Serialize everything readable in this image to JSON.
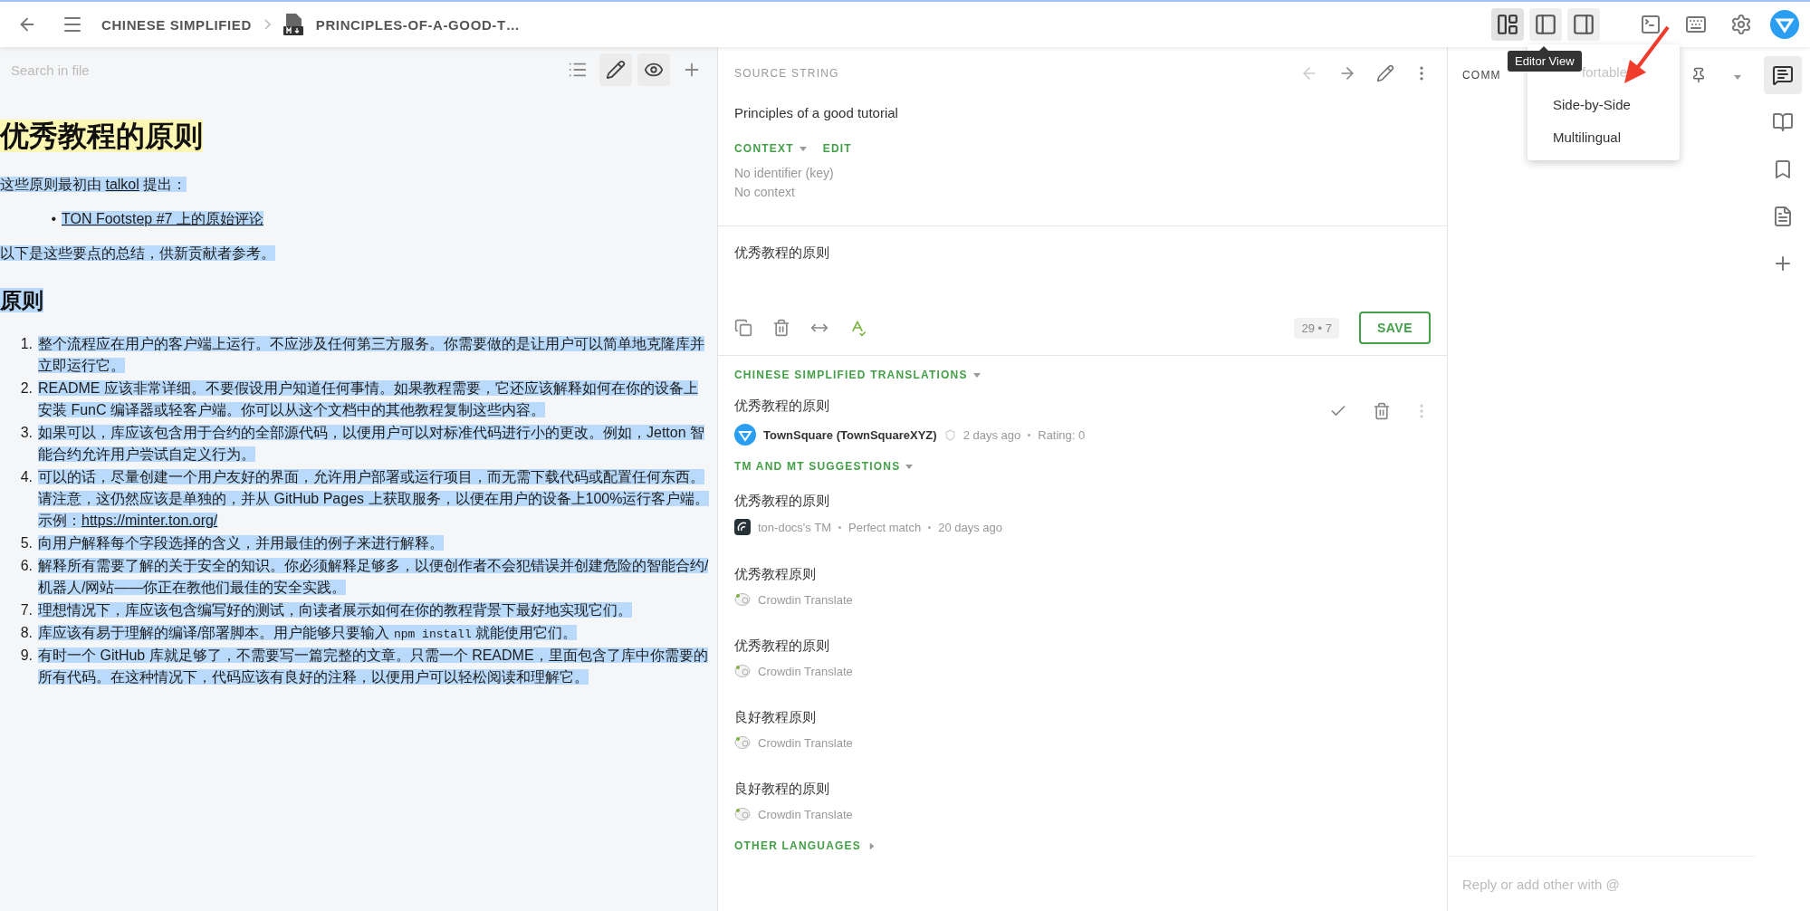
{
  "top_bar": {
    "breadcrumb": [
      {
        "label": "CHINESE SIMPLIFIED"
      },
      {
        "label": "PRINCIPLES-OF-A-GOOD-T…"
      }
    ],
    "layout_buttons": [
      {
        "kind": "editor",
        "selected": true
      },
      {
        "kind": "left",
        "selected": false
      },
      {
        "kind": "right",
        "selected": false
      }
    ],
    "tooltip": "Editor View"
  },
  "view_menu": {
    "items": [
      {
        "label": "fortable",
        "disabled": true
      },
      {
        "label": "Side-by-Side",
        "disabled": false
      },
      {
        "label": "Multilingual",
        "disabled": false
      }
    ]
  },
  "file_panel": {
    "search": {
      "placeholder": "Search in file"
    },
    "tools": [
      {
        "kind": "list",
        "selected": false
      },
      {
        "kind": "edit",
        "selected": true
      },
      {
        "kind": "preview",
        "selected": true
      },
      {
        "kind": "add",
        "selected": false
      }
    ],
    "blocks": [
      {
        "kind": "h1",
        "active": true,
        "selected": false,
        "text": "优秀教程的原则"
      },
      {
        "kind": "p",
        "active": false,
        "selected": true,
        "parts": [
          {
            "kind": "text",
            "text": "这些原则最初由 "
          },
          {
            "kind": "link",
            "text": "talkol"
          },
          {
            "kind": "text",
            "text": " 提出："
          }
        ]
      },
      {
        "kind": "ul",
        "active": false,
        "selected": true,
        "items": [
          {
            "marker": "•",
            "parts": [
              {
                "kind": "link",
                "text": "TON Footstep #7 上的原始评论"
              }
            ]
          }
        ]
      },
      {
        "kind": "p",
        "active": false,
        "selected": true,
        "parts": [
          {
            "kind": "text",
            "text": "以下是这些要点的总结，供新贡献者参考。"
          }
        ]
      },
      {
        "kind": "h2",
        "active": false,
        "selected": true,
        "text": "原则"
      },
      {
        "kind": "ol",
        "active": false,
        "selected": true,
        "items": [
          {
            "marker": "1.",
            "parts": [
              {
                "kind": "text",
                "text": "整个流程应在用户的客户端上运行。不应涉及任何第三方服务。你需要做的是让用户可以简单地克隆库并立即运行它。"
              }
            ]
          },
          {
            "marker": "2.",
            "parts": [
              {
                "kind": "text",
                "text": "README 应该非常详细。不要假设用户知道任何事情。如果教程需要，它还应该解释如何在你的设备上安装 FunC 编译器或轻客户端。你可以从这个文档中的其他教程复制这些内容。"
              }
            ]
          },
          {
            "marker": "3.",
            "parts": [
              {
                "kind": "text",
                "text": "如果可以，库应该包含用于合约的全部源代码，以便用户可以对标准代码进行小的更改。例如，Jetton 智能合约允许用户尝试自定义行为。"
              }
            ]
          },
          {
            "marker": "4.",
            "parts": [
              {
                "kind": "text",
                "text": "可以的话，尽量创建一个用户友好的界面，允许用户部署或运行项目，而无需下载代码或配置任何东西。请注意，这仍然应该是单独的，并从 GitHub Pages 上获取服务，以便在用户的设备上100%运行客户端。示例："
              },
              {
                "kind": "link",
                "text": "https://minter.ton.org/"
              }
            ]
          },
          {
            "marker": "5.",
            "parts": [
              {
                "kind": "text",
                "text": "向用户解释每个字段选择的含义，并用最佳的例子来进行解释。"
              }
            ]
          },
          {
            "marker": "6.",
            "parts": [
              {
                "kind": "text",
                "text": "解释所有需要了解的关于安全的知识。你必须解释足够多，以便创作者不会犯错误并创建危险的智能合约/机器人/网站——你正在教他们最佳的安全实践。"
              }
            ]
          },
          {
            "marker": "7.",
            "parts": [
              {
                "kind": "text",
                "text": "理想情况下，库应该包含编写好的测试，向读者展示如何在你的教程背景下最好地实现它们。"
              }
            ]
          },
          {
            "marker": "8.",
            "parts": [
              {
                "kind": "text",
                "text": "库应该有易于理解的编译/部署脚本。用户能够只要输入 "
              },
              {
                "kind": "code",
                "text": "npm install"
              },
              {
                "kind": "text",
                "text": " 就能使用它们。"
              }
            ]
          },
          {
            "marker": "9.",
            "parts": [
              {
                "kind": "text",
                "text": "有时一个 GitHub 库就足够了，不需要写一篇完整的文章。只需一个 README，里面包含了库中你需要的所有代码。在这种情况下，代码应该有良好的注释，以便用户可以轻松阅读和理解它。"
              }
            ]
          }
        ]
      }
    ]
  },
  "source": {
    "title": "SOURCE STRING",
    "text": "Principles of a good tutorial",
    "context_label": "CONTEXT",
    "edit_label": "EDIT",
    "context_lines": [
      "No identifier (key)",
      "No context"
    ]
  },
  "editor": {
    "value": "优秀教程的原则",
    "counter": "29 • 7",
    "save": "SAVE"
  },
  "translations": {
    "title": "CHINESE SIMPLIFIED TRANSLATIONS",
    "items": [
      {
        "text": "优秀教程的原则",
        "author": "TownSquare (TownSquareXYZ)",
        "meta": [
          "2 days ago",
          "Rating: 0"
        ]
      }
    ]
  },
  "suggestions": {
    "title": "TM AND MT SUGGESTIONS",
    "items": [
      {
        "kind": "tm",
        "text": "优秀教程的原则",
        "meta": [
          "ton-docs's TM",
          "Perfect match",
          "20 days ago"
        ]
      },
      {
        "kind": "mt",
        "text": "优秀教程原则",
        "meta": [
          "Crowdin Translate"
        ]
      },
      {
        "kind": "mt",
        "text": "优秀教程的原则",
        "meta": [
          "Crowdin Translate"
        ]
      },
      {
        "kind": "mt",
        "text": "良好教程原则",
        "meta": [
          "Crowdin Translate"
        ]
      },
      {
        "kind": "mt",
        "text": "良好教程的原则",
        "meta": [
          "Crowdin Translate"
        ]
      }
    ]
  },
  "other_languages": "OTHER LANGUAGES",
  "comments": {
    "title": "COMM",
    "reply_placeholder": "Reply or add other with @"
  },
  "side_bar": [
    {
      "kind": "comments",
      "selected": true
    },
    {
      "kind": "glossary",
      "selected": false
    },
    {
      "kind": "tm",
      "selected": false
    },
    {
      "kind": "info",
      "selected": false
    },
    {
      "kind": "add",
      "selected": false
    }
  ]
}
